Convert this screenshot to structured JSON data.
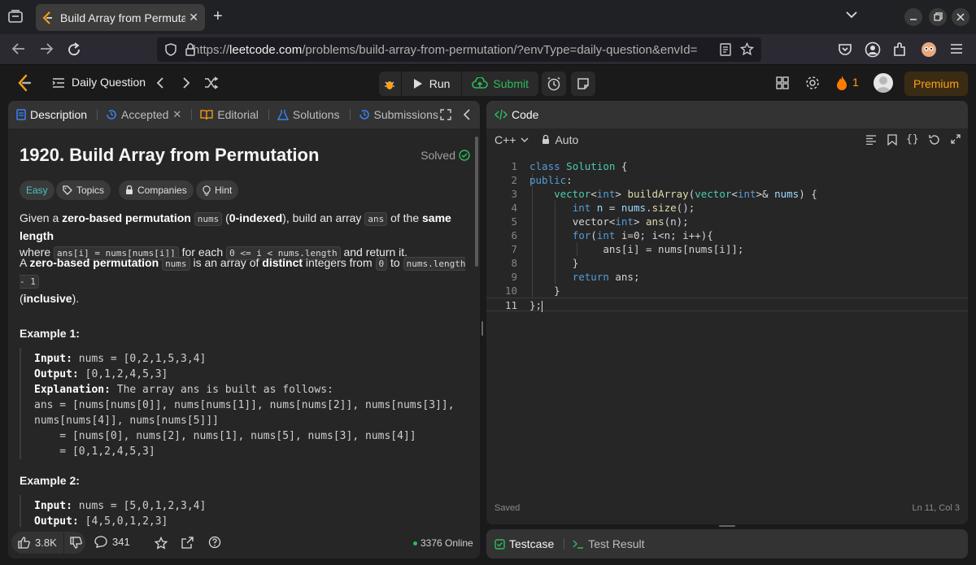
{
  "browser": {
    "tab_title": "Build Array from Permutation",
    "url_scheme": "https://",
    "url_host": "leetcode.com",
    "url_path": "/problems/build-array-from-permutation/?envType=daily-question&envId="
  },
  "nav": {
    "daily_question": "Daily Question",
    "run_label": "Run",
    "submit_label": "Submit",
    "streak_count": "1",
    "premium_label": "Premium"
  },
  "left_tabs": {
    "description": "Description",
    "accepted": "Accepted",
    "editorial": "Editorial",
    "solutions": "Solutions",
    "submissions": "Submissions"
  },
  "problem": {
    "title": "1920. Build Array from Permutation",
    "status": "Solved",
    "difficulty": "Easy",
    "chips": {
      "topics": "Topics",
      "companies": "Companies",
      "hint": "Hint"
    },
    "desc1": {
      "t1": "Given a ",
      "b1": "zero-based permutation",
      "t2": " ",
      "c1": "nums",
      "t3": " (",
      "b2": "0-indexed",
      "t4": "), build an array ",
      "c2": "ans",
      "t5": " of the ",
      "b3": "same length",
      "t6": "where ",
      "c3": "ans[i] = nums[nums[i]]",
      "t7": " for each ",
      "c4": "0 <= i < nums.length",
      "t8": " and return it."
    },
    "desc2": {
      "t1": "A ",
      "b1": "zero-based permutation",
      "t2": " ",
      "c1": "nums",
      "t3": " is an array of ",
      "b2": "distinct",
      "t4": " integers from ",
      "c2": "0",
      "t5": " to ",
      "c3": "nums.length - 1",
      "t6": "(",
      "b3": "inclusive",
      "t7": ")."
    },
    "example1": {
      "heading": "Example 1:",
      "input_label": "Input:",
      "input_value": " nums = [0,2,1,5,3,4]",
      "output_label": "Output:",
      "output_value": " [0,1,2,4,5,3]",
      "explanation_label": "Explanation:",
      "explanation_value": " The array ans is built as follows:",
      "line4": "ans = [nums[nums[0]], nums[nums[1]], nums[nums[2]], nums[nums[3]],",
      "line5": "nums[nums[4]], nums[nums[5]]]",
      "line6": "    = [nums[0], nums[2], nums[1], nums[5], nums[3], nums[4]]",
      "line7": "    = [0,1,2,4,5,3]"
    },
    "example2": {
      "heading": "Example 2:",
      "input_label": "Input:",
      "input_value": " nums = [5,0,1,2,3,4]",
      "output_label": "Output:",
      "output_value": " [4,5,0,1,2,3]"
    }
  },
  "footer": {
    "likes": "3.8K",
    "comments": "341",
    "online": "3376 Online"
  },
  "code_panel": {
    "tab_label": "Code",
    "language": "C++",
    "mode": "Auto",
    "saved": "Saved",
    "cursor": "Ln 11, Col 3",
    "line_numbers": [
      "1",
      "2",
      "3",
      "4",
      "5",
      "6",
      "7",
      "8",
      "9",
      "10",
      "11"
    ]
  },
  "test_panel": {
    "testcase": "Testcase",
    "test_result": "Test Result"
  },
  "colors": {
    "accent": "#ffa116",
    "easy": "#46c6c2",
    "success": "#2cbb5d",
    "bg": "#1a1a1a",
    "panel": "#262626"
  }
}
